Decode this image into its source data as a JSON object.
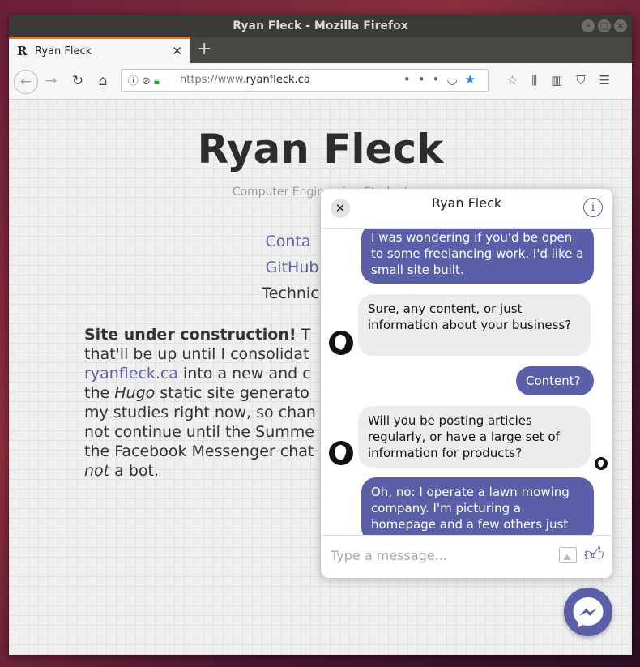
{
  "window": {
    "title": "Ryan Fleck - Mozilla Firefox"
  },
  "tab": {
    "title": "Ryan Fleck",
    "favicon": "R"
  },
  "urlbar": {
    "url_prefix": "https://www.",
    "url_domain": "ryanfleck.ca"
  },
  "page": {
    "title": "Ryan Fleck",
    "subtitle": "Computer Engineering Student",
    "nav": [
      {
        "label": "Conta"
      },
      {
        "label": "GitHub"
      },
      {
        "label": "Technic"
      }
    ],
    "paragraph": {
      "bold": "Site under construction!",
      "p1": " T",
      "line2": "that'll be up until I consolidat",
      "link": "ryanfleck.ca",
      "line3": " into a new and c",
      "line4a": "the ",
      "hugo": "Hugo",
      "line4b": " static site generato",
      "line5": "my studies right now, so chan",
      "line6": "not continue until the Summe",
      "line7": "the Facebook Messenger chat",
      "not": "not",
      "line8": " a bot."
    }
  },
  "chat": {
    "title": "Ryan Fleck",
    "input_placeholder": "Type a message...",
    "messages": [
      {
        "from": "user",
        "text": "I was wondering if you'd be open to some freelancing work. I'd like a small site built."
      },
      {
        "from": "page",
        "text": "Sure, any content, or just information about your business?"
      },
      {
        "from": "user",
        "text": "Content?"
      },
      {
        "from": "page",
        "text": "Will you be posting articles regularly, or have a large set of information for products?"
      },
      {
        "from": "user",
        "text": "Oh, no: I operate a lawn mowing company. I'm picturing a homepage and a few others just"
      }
    ]
  },
  "colors": {
    "accent": "#5b5fa8",
    "tab_highlight": "#e8742d"
  }
}
